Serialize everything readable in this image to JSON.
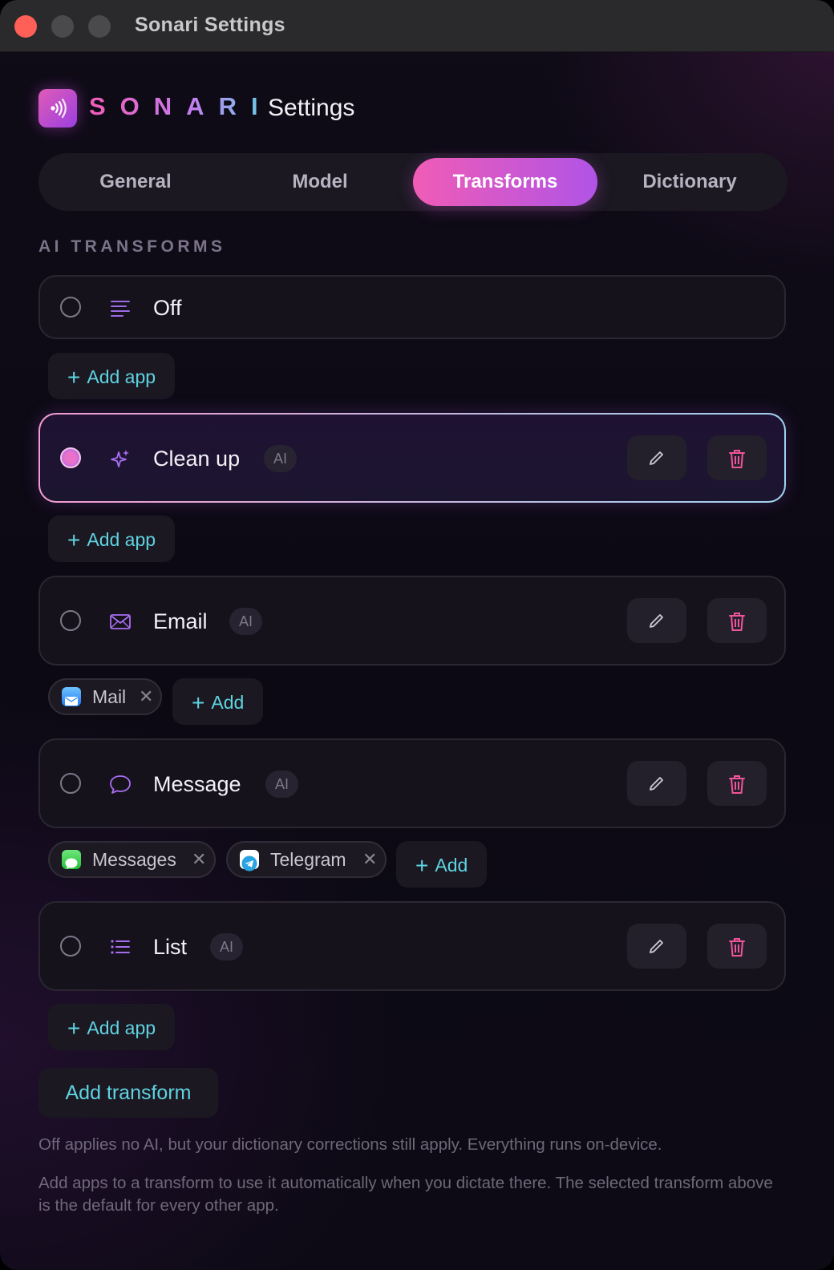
{
  "window": {
    "title": "Sonari Settings"
  },
  "header": {
    "brand": "SONARI",
    "title": "Settings",
    "logo_icon": "waveform-icon"
  },
  "tabs": [
    {
      "label": "General",
      "active": false
    },
    {
      "label": "Model",
      "active": false
    },
    {
      "label": "Transforms",
      "active": true
    },
    {
      "label": "Dictionary",
      "active": false
    }
  ],
  "section_label": "AI TRANSFORMS",
  "transforms": [
    {
      "name": "Off",
      "icon": "lines-icon",
      "badge": null,
      "selected": false,
      "add_label": "Add app",
      "apps": []
    },
    {
      "name": "Clean up",
      "icon": "sparkles-icon",
      "badge": "AI",
      "selected": true,
      "add_label": "Add app",
      "apps": []
    },
    {
      "name": "Email",
      "icon": "envelope-icon",
      "badge": "AI",
      "selected": false,
      "add_label": "Add",
      "apps": [
        "Mail"
      ]
    },
    {
      "name": "Message",
      "icon": "chat-bubble-icon",
      "badge": "AI",
      "selected": false,
      "add_label": "Add",
      "apps": [
        "Messages",
        "Telegram"
      ]
    },
    {
      "name": "List",
      "icon": "list-icon",
      "badge": "AI",
      "selected": false,
      "add_label": "Add app",
      "apps": []
    }
  ],
  "add_transform_label": "Add transform",
  "notes": [
    "Off applies no AI, but your dictionary corrections still apply. Everything runs on-device.",
    "Add apps to a transform to use it automatically when you dictate there. The selected transform above is the default for every other app."
  ],
  "colors": {
    "accent_pink": "#f05cb6",
    "accent_purple": "#b054e6",
    "accent_cyan": "#5fd3e0",
    "delete": "#f0549a"
  }
}
